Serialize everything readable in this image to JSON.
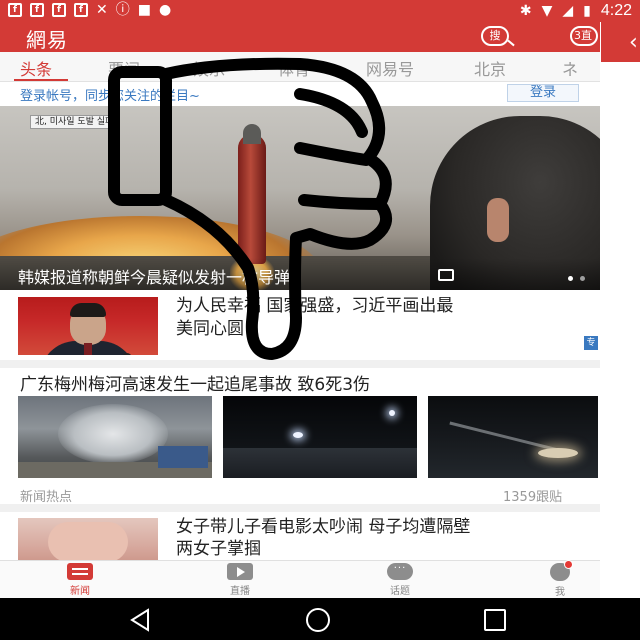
{
  "status_bar": {
    "time": "4:22",
    "left_icons": [
      "facebook-icon",
      "facebook-icon",
      "facebook-icon",
      "facebook-icon",
      "tools-icon",
      "alert-icon",
      "lock-icon",
      "android-icon"
    ],
    "right_icons": [
      "bluetooth-icon",
      "wifi-icon",
      "signal-icon",
      "battery-icon"
    ]
  },
  "header": {
    "logo": "網易",
    "search_label": "搜",
    "top_label": "3直",
    "accent_color": "#d33a36"
  },
  "tabs": [
    {
      "label": "头条",
      "active": true
    },
    {
      "label": "要闻",
      "active": false
    },
    {
      "label": "娱乐",
      "active": false
    },
    {
      "label": "体育",
      "active": false
    },
    {
      "label": "网易号",
      "active": false
    },
    {
      "label": "北京",
      "active": false
    },
    {
      "label": "ネ",
      "active": false
    }
  ],
  "login_banner": {
    "text": "登录帐号，同步您关注的栏目~",
    "button": "登录"
  },
  "hero": {
    "ticker": "北, 미사일 도발 실패",
    "caption": "韩媒报道称朝鲜今晨疑似发射一枚导弹",
    "slides": 2,
    "active_slide": 1
  },
  "feed": {
    "item1": {
      "title_line1": "为人民幸福  国家强盛，习近平画出最",
      "title_line2": "美同心圆",
      "tag": "专"
    },
    "photo_set": {
      "title": "广东梅州梅河高速发生一起追尾事故 致6死3伤",
      "source": "新闻热点",
      "comments": "1359跟贴"
    },
    "item3": {
      "title_line1": "女子带儿子看电影太吵闹 母子均遭隔壁",
      "title_line2": "两女子掌掴"
    }
  },
  "bottom_nav": [
    {
      "label": "新闻",
      "icon": "news-icon",
      "active": true
    },
    {
      "label": "直播",
      "icon": "play-icon",
      "active": false
    },
    {
      "label": "话题",
      "icon": "chat-icon",
      "active": false
    },
    {
      "label": "我",
      "icon": "profile-icon",
      "active": false
    }
  ],
  "overlay": {
    "icon": "thumbs-down-icon"
  }
}
